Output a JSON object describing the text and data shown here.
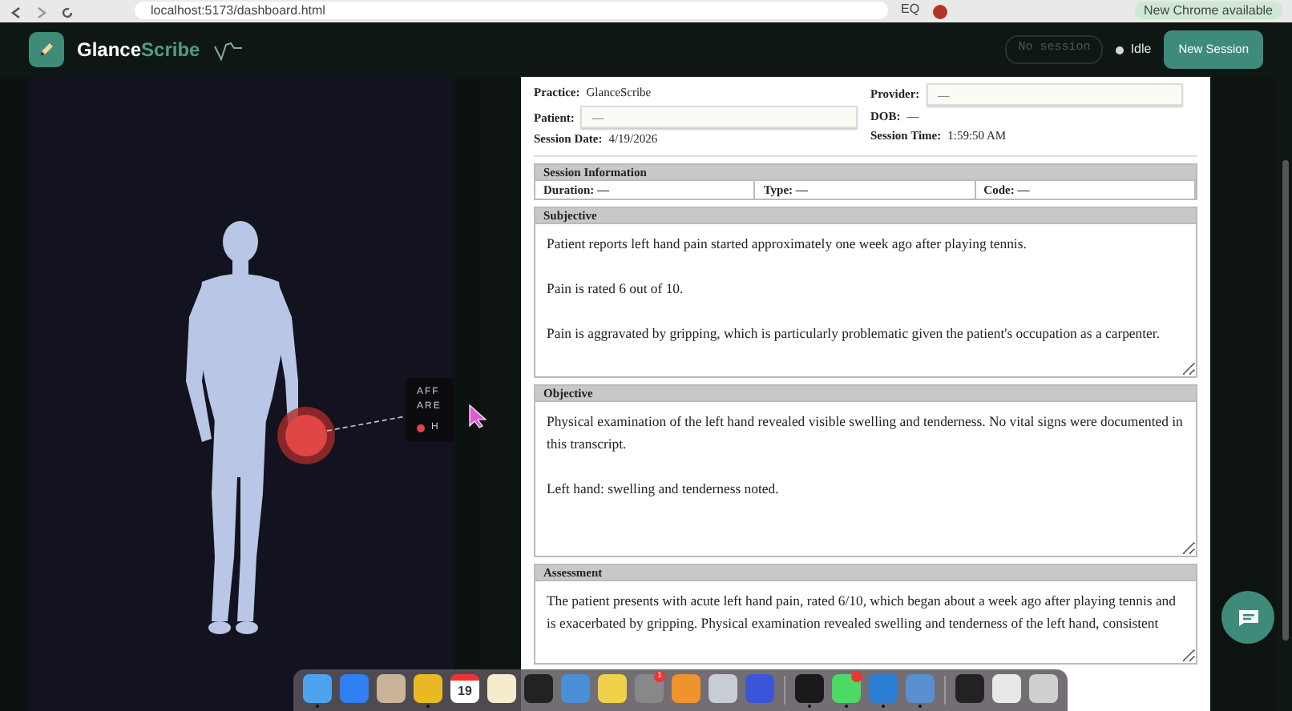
{
  "browser": {
    "url": "localhost:5173/dashboard.html",
    "extension_label": "EQ",
    "update_pill": "New Chrome available"
  },
  "header": {
    "brand": [
      "Glance",
      "Scribe"
    ],
    "session_pill": "No session",
    "status_label": "Idle",
    "new_session_button": "New Session"
  },
  "body_view": {
    "callout": {
      "title_lines": [
        "AFF",
        "ARE"
      ],
      "items": [
        {
          "label": "H"
        }
      ]
    }
  },
  "note": {
    "practice": {
      "label": "Practice:",
      "value": "GlanceScribe"
    },
    "provider": {
      "label": "Provider:",
      "value": "—"
    },
    "patient": {
      "label": "Patient:",
      "value": "—"
    },
    "dob": {
      "label": "DOB:",
      "value": "—"
    },
    "session_date": {
      "label": "Session Date:",
      "value": "4/19/2026"
    },
    "session_time": {
      "label": "Session Time:",
      "value": "1:59:50 AM"
    },
    "session_information": {
      "title": "Session Information",
      "fields": [
        {
          "label": "Duration:",
          "value": "—"
        },
        {
          "label": "Type:",
          "value": "—"
        },
        {
          "label": "Code:",
          "value": "—"
        }
      ]
    },
    "sections": [
      {
        "title": "Subjective",
        "text": "Patient reports left hand pain started approximately one week ago after playing tennis.\n\nPain is rated 6 out of 10.\n\nPain is aggravated by gripping, which is particularly problematic given the patient's occupation as a carpenter."
      },
      {
        "title": "Objective",
        "text": "Physical examination of the left hand revealed visible swelling and tenderness. No vital signs were documented in this transcript.\n\nLeft hand: swelling and tenderness noted."
      },
      {
        "title": "Assessment",
        "text": "The patient presents with acute left hand pain, rated 6/10, which began about a week ago after playing tennis and is exacerbated by gripping. Physical examination revealed swelling and tenderness of the left hand, consistent"
      }
    ]
  },
  "dock": {
    "calendar_day": "19",
    "apps": [
      {
        "running": true,
        "notified": false
      },
      {
        "running": false,
        "notified": false
      },
      {
        "running": false,
        "notified": false
      },
      {
        "running": true,
        "notified": false
      },
      {
        "running": false,
        "notified": false
      },
      {
        "running": false,
        "notified": false
      },
      {
        "running": false,
        "notified": false
      },
      {
        "running": false,
        "notified": false
      },
      {
        "running": false,
        "notified": false
      },
      {
        "running": false,
        "notified": true,
        "badge": "1"
      },
      {
        "running": false,
        "notified": false
      },
      {
        "running": false,
        "notified": false
      },
      {
        "running": false,
        "notified": false
      },
      {
        "running": true,
        "notified": false
      },
      {
        "running": true,
        "notified": true
      },
      {
        "running": true,
        "notified": false
      },
      {
        "running": true,
        "notified": false
      },
      {
        "running": false,
        "notified": false
      },
      {
        "running": false,
        "notified": false
      },
      {
        "running": false,
        "notified": false
      }
    ]
  }
}
